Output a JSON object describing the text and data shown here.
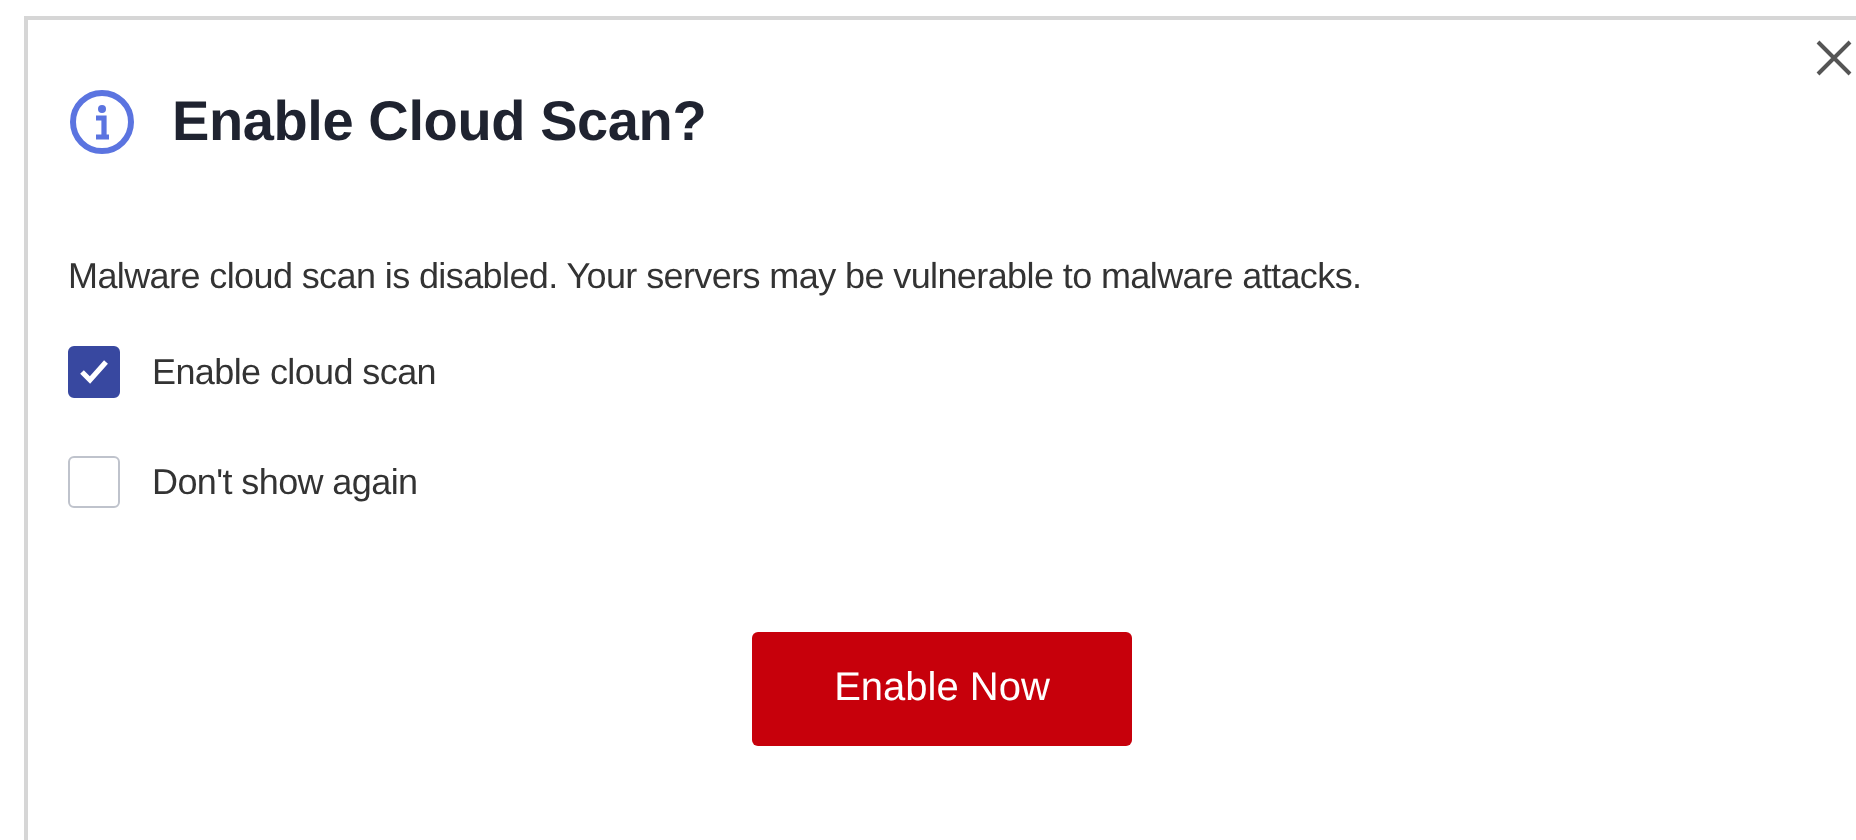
{
  "dialog": {
    "title": "Enable Cloud Scan?",
    "message": "Malware cloud scan is disabled. Your servers may be vulnerable to malware attacks.",
    "options": [
      {
        "label": "Enable cloud scan",
        "checked": true
      },
      {
        "label": "Don't show again",
        "checked": false
      }
    ],
    "buttons": [
      {
        "label": "Enable Now",
        "kind": "primary"
      }
    ]
  }
}
